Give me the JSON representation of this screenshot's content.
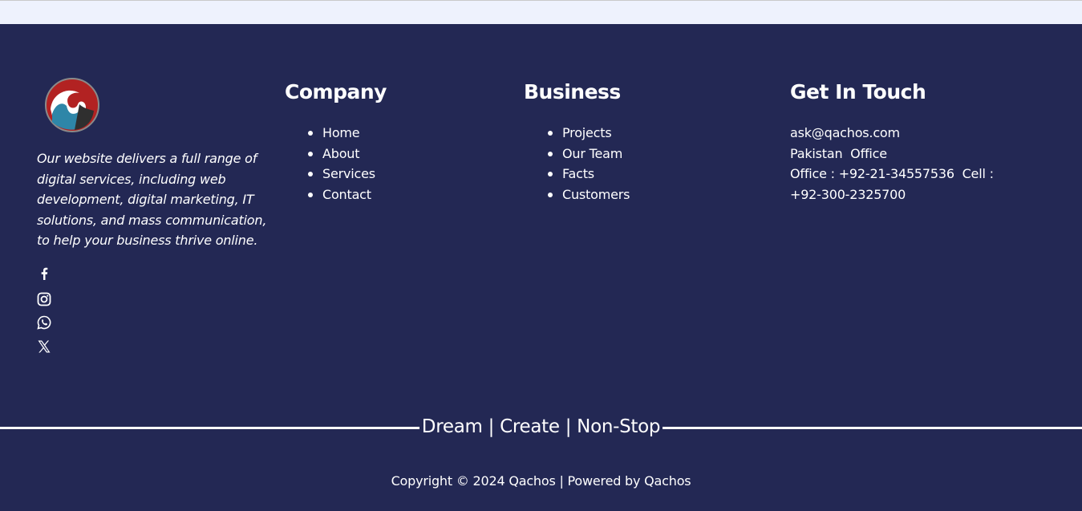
{
  "brand": {
    "logo_icon": "qachos-wave-logo",
    "colors": {
      "footer_bg": "#232854",
      "logo_red": "#b22222",
      "logo_blue": "#2e86a8"
    }
  },
  "about": {
    "description": "Our website delivers a full range of digital services, including web development, digital marketing, IT solutions, and mass communication, to help your business thrive online."
  },
  "social": [
    {
      "icon": "facebook-icon"
    },
    {
      "icon": "instagram-icon"
    },
    {
      "icon": "whatsapp-icon"
    },
    {
      "icon": "x-twitter-icon"
    }
  ],
  "company": {
    "heading": "Company",
    "links": [
      "Home",
      "About",
      "Services",
      "Contact"
    ]
  },
  "business": {
    "heading": "Business",
    "links": [
      "Projects",
      "Our Team",
      "Facts",
      "Customers"
    ]
  },
  "contact": {
    "heading": "Get In Touch",
    "email": "ask@qachos.com",
    "office_label": "Pakistan  Office",
    "phones_line1": "Office : +92-21-34557536  Cell :",
    "phones_line2": "+92-300-2325700"
  },
  "tagline": "Dream | Create | Non-Stop",
  "copyright": "Copyright © 2024 Qachos | Powered by Qachos"
}
